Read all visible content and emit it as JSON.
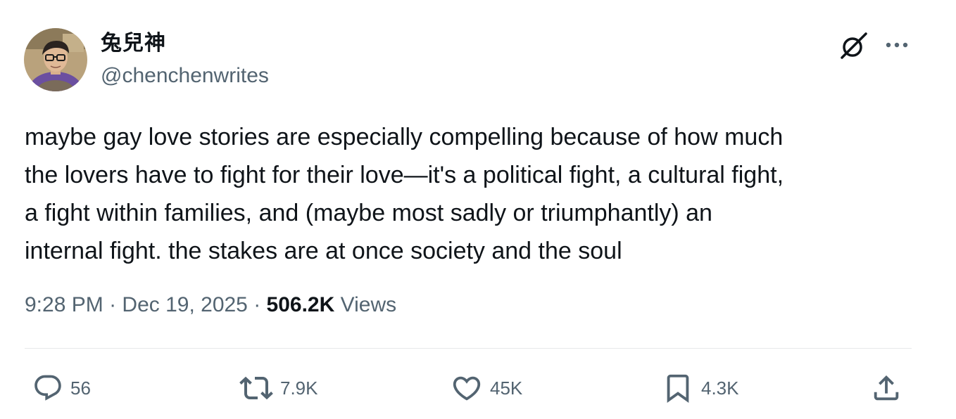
{
  "author": {
    "display_name": "兔兒神",
    "handle": "@chenchenwrites"
  },
  "header_icons": {
    "grok": "grok-icon",
    "more": "more-icon"
  },
  "tweet": {
    "text": "maybe gay love stories are especially compelling because of how much\nthe lovers have to fight for their love—it's a political fight, a cultural fight,\na fight within families, and (maybe most sadly or triumphantly) an\ninternal fight. the stakes are at once society and the soul"
  },
  "meta": {
    "time": "9:28 PM",
    "separator": " · ",
    "date": "Dec 19, 2025",
    "views_count": "506.2K",
    "views_label": " Views"
  },
  "actions": {
    "replies": "56",
    "reposts": "7.9K",
    "likes": "45K",
    "bookmarks": "4.3K"
  },
  "colors": {
    "text": "#0f1419",
    "secondary": "#536471",
    "divider": "#e7e9ea"
  }
}
